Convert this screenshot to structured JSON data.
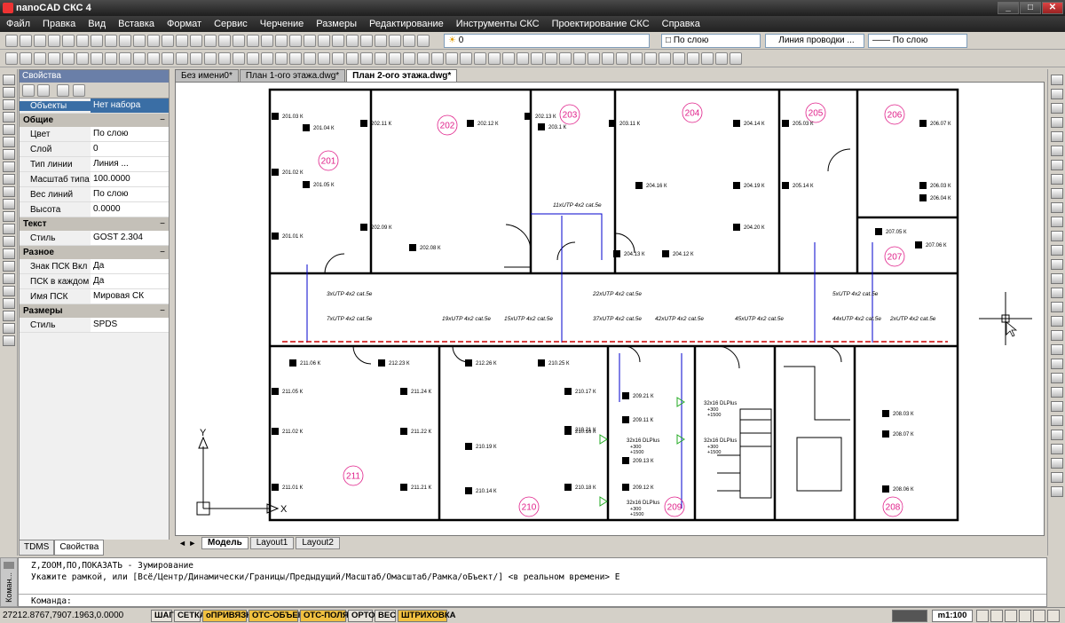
{
  "window": {
    "title": "nanoCAD СКС 4"
  },
  "menu": [
    "Файл",
    "Правка",
    "Вид",
    "Вставка",
    "Формат",
    "Сервис",
    "Черчение",
    "Размеры",
    "Редактирование",
    "Инструменты СКС",
    "Проектирование СКС",
    "Справка"
  ],
  "toolbar": {
    "layer_value": "0",
    "color_combo": "По слою",
    "linetype_combo": "Линия проводки ...",
    "lineweight_combo": "По слою"
  },
  "properties": {
    "header": "Свойства",
    "selector": {
      "key": "Объекты",
      "value": "Нет набора"
    },
    "sections": [
      {
        "title": "Общие",
        "rows": [
          {
            "k": "Цвет",
            "v": "По слою"
          },
          {
            "k": "Слой",
            "v": "0"
          },
          {
            "k": "Тип линии",
            "v": "Линия ..."
          },
          {
            "k": "Масштаб типа ...",
            "v": "100.0000"
          },
          {
            "k": "Вес линий",
            "v": "По слою"
          },
          {
            "k": "Высота",
            "v": "0.0000"
          }
        ]
      },
      {
        "title": "Текст",
        "rows": [
          {
            "k": "Стиль",
            "v": "GOST 2.304"
          }
        ]
      },
      {
        "title": "Разное",
        "rows": [
          {
            "k": "Знак ПСК Вкл",
            "v": "Да"
          },
          {
            "k": "ПСК в каждом ...",
            "v": "Да"
          },
          {
            "k": "Имя ПСК",
            "v": "Мировая СК"
          }
        ]
      },
      {
        "title": "Размеры",
        "rows": [
          {
            "k": "Стиль",
            "v": "SPDS"
          }
        ]
      }
    ],
    "tabs": [
      "TDMS",
      "Свойства"
    ]
  },
  "doc_tabs": [
    "Без имени0*",
    "План 1-ого этажа.dwg*",
    "План 2-ого этажа.dwg*"
  ],
  "layout_tabs": [
    "Модель",
    "Layout1",
    "Layout2"
  ],
  "drawing": {
    "rooms": [
      "201",
      "202",
      "203",
      "204",
      "205",
      "206",
      "207",
      "211",
      "210",
      "209",
      "208"
    ],
    "axis_y": "Y",
    "axis_x": "X",
    "cable_labels": [
      "3xUTP 4x2 cat.5e",
      "7xUTP 4x2 cat.5e",
      "22xUTP 4x2 cat.5e",
      "5xUTP 4x2 cat.5e",
      "19xUTP 4x2 cat.5e",
      "15xUTP 4x2 cat.5e",
      "37xUTP 4x2 cat.5e",
      "42xUTP 4x2 cat.5e",
      "45xUTP 4x2 cat.5e",
      "44xUTP 4x2 cat.5e",
      "2xUTP 4x2 cat.5e",
      "11xUTP 4x2 cat.5e"
    ],
    "outlets_top": [
      "201.03 К",
      "201.04 К",
      "201.02 К",
      "201.05 К",
      "201.01 К",
      "202.11 К",
      "202.12 К",
      "202.13 К",
      "202.09 К",
      "202.08 К",
      "203.1 К",
      "203.11 К",
      "204.13 К",
      "204.14 К",
      "204.16 К",
      "204.19 К",
      "204.12 К",
      "204.20 К",
      "205.03 К",
      "205.14 К",
      "206.07 К",
      "206.03 К",
      "206.04 К",
      "207.05 К",
      "207.06 К"
    ],
    "outlets_bottom": [
      "211.06 К",
      "212.23 К",
      "212.26 К",
      "210.25 К",
      "211.05 К",
      "211.24 К",
      "210.17 К",
      "210.16 К",
      "211.02 К",
      "211.22 К",
      "210.21 К",
      "210.19 К",
      "211.01 К",
      "211.21 К",
      "210.18 К",
      "210.14 К",
      "209.21 К",
      "209.11 К",
      "209.13 К",
      "209.12 К",
      "208.03 К",
      "208.07 К",
      "208.06 К"
    ],
    "dlink_labels": [
      "32x16 DLPlus",
      "32x16 DLPlus",
      "32x16 DLPlus",
      "32x16 DLPlus"
    ],
    "dlink_sub": [
      "+300",
      "+1500"
    ]
  },
  "command": {
    "line1": "Z,ZOOM,ПО,ПОКАЗАТЬ - Зумирование",
    "line2": "Укажите рамкой, или [Всё/Центр/Динамически/Границы/Предыдущий/Масштаб/Омасштаб/Рамка/оБъект/] <в реальном времени> Е",
    "prompt": "Команда:",
    "side_label": "Коман..."
  },
  "status": {
    "coords": "27212.8767,7907.1963,0.0000",
    "buttons": [
      {
        "label": "ШАГ",
        "on": false
      },
      {
        "label": "СЕТКА",
        "on": false
      },
      {
        "label": "оПРИВЯЗКА",
        "on": true
      },
      {
        "label": "ОТС-ОБЪЕКТ",
        "on": true
      },
      {
        "label": "ОТС-ПОЛЯР",
        "on": true
      },
      {
        "label": "ОРТО",
        "on": false
      },
      {
        "label": "ВЕС",
        "on": false
      },
      {
        "label": "ШТРИХОВКА",
        "on": true
      }
    ],
    "scale": "m1:100"
  },
  "colors": {
    "wall": "#000000",
    "cable_blue": "#0000cc",
    "cable_red": "#cc0000",
    "room_label": "#e0208a",
    "outlet_cyan": "#00a0c0",
    "dlink_green": "#22aa22"
  }
}
